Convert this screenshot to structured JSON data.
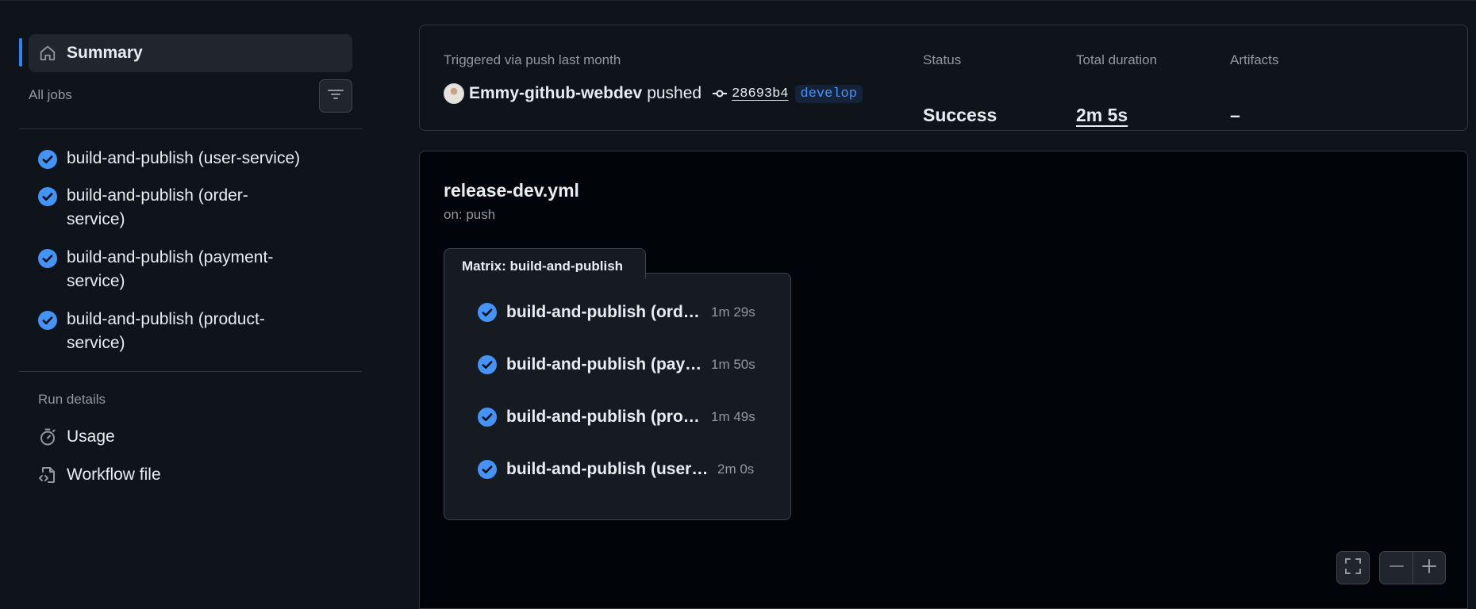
{
  "sidebar": {
    "summary_label": "Summary",
    "all_jobs_label": "All jobs",
    "jobs": [
      {
        "label": "build-and-publish (user-service)"
      },
      {
        "label": "build-and-publish (order-service)"
      },
      {
        "label": "build-and-publish (payment-service)"
      },
      {
        "label": "build-and-publish (product-service)"
      }
    ],
    "run_details_label": "Run details",
    "usage_label": "Usage",
    "workflow_file_label": "Workflow file"
  },
  "run_summary": {
    "trigger_text": "Triggered via push last month",
    "actor": "Emmy-github-webdev",
    "action": "pushed",
    "commit_sha": "28693b4",
    "branch": "develop",
    "status_label": "Status",
    "status_value": "Success",
    "duration_label": "Total duration",
    "duration_value": "2m 5s",
    "artifacts_label": "Artifacts",
    "artifacts_value": "–"
  },
  "workflow": {
    "file_name": "release-dev.yml",
    "trigger": "on: push",
    "matrix_label": "Matrix: build-and-publish",
    "matrix_jobs": [
      {
        "name": "build-and-publish (order-service)",
        "duration": "1m 29s"
      },
      {
        "name": "build-and-publish (payment-service)",
        "duration": "1m 50s"
      },
      {
        "name": "build-and-publish (product-service)",
        "duration": "1m 49s"
      },
      {
        "name": "build-and-publish (user-service)",
        "duration": "2m 0s"
      }
    ]
  },
  "icons": {
    "summary": "home-icon",
    "filter": "filter-icon",
    "job_status": "check-circle-icon",
    "usage": "stopwatch-icon",
    "workflow_file": "file-code-icon",
    "commit": "git-commit-icon",
    "fullscreen": "fullscreen-icon",
    "zoom_out": "minus-icon",
    "zoom_in": "plus-icon"
  },
  "colors": {
    "accent": "#2f81f7",
    "success_check": "#4493f8",
    "background": "#0f141b",
    "graph_background": "#010409"
  }
}
